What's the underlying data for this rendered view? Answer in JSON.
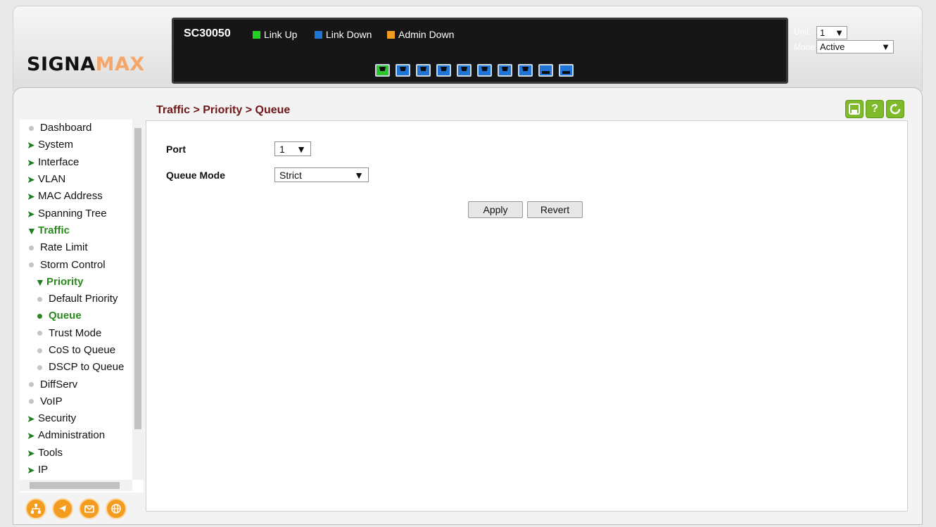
{
  "header": {
    "logo_main": "SIGNA",
    "logo_accent": "MAX",
    "model": "SC30050",
    "legend": [
      {
        "label": "Link Up",
        "color": "#22d022"
      },
      {
        "label": "Link Down",
        "color": "#1f74d6"
      },
      {
        "label": "Admin Down",
        "color": "#f29c1f"
      }
    ],
    "ports": [
      "up",
      "down",
      "down",
      "down",
      "down",
      "down",
      "down",
      "down",
      "sfp",
      "sfp"
    ],
    "unit_label": "Unit",
    "unit_value": "1",
    "mode_label": "Mode",
    "mode_value": "Active"
  },
  "sidebar": {
    "items": [
      {
        "label": "Dashboard",
        "type": "leaf"
      },
      {
        "label": "System",
        "type": "folder"
      },
      {
        "label": "Interface",
        "type": "folder"
      },
      {
        "label": "VLAN",
        "type": "folder"
      },
      {
        "label": "MAC Address",
        "type": "folder"
      },
      {
        "label": "Spanning Tree",
        "type": "folder"
      },
      {
        "label": "Traffic",
        "type": "open"
      },
      {
        "label": "Rate Limit",
        "type": "leaf"
      },
      {
        "label": "Storm Control",
        "type": "leaf"
      },
      {
        "label": "Priority",
        "type": "open"
      },
      {
        "label": "Default Priority",
        "type": "leaf"
      },
      {
        "label": "Queue",
        "type": "current"
      },
      {
        "label": "Trust Mode",
        "type": "leaf"
      },
      {
        "label": "CoS to Queue",
        "type": "leaf"
      },
      {
        "label": "DSCP to Queue",
        "type": "leaf"
      },
      {
        "label": "DiffServ",
        "type": "leaf"
      },
      {
        "label": "VoIP",
        "type": "leaf"
      },
      {
        "label": "Security",
        "type": "folder"
      },
      {
        "label": "Administration",
        "type": "folder"
      },
      {
        "label": "Tools",
        "type": "folder"
      },
      {
        "label": "IP",
        "type": "folder"
      }
    ]
  },
  "content": {
    "breadcrumb": "Traffic > Priority > Queue",
    "port_label": "Port",
    "port_value": "1",
    "queue_mode_label": "Queue Mode",
    "queue_mode_value": "Strict",
    "apply_label": "Apply",
    "revert_label": "Revert"
  },
  "toolbar": {
    "save_icon": "save-icon",
    "help_icon": "help-icon",
    "refresh_icon": "refresh-icon"
  },
  "bottom_icons": [
    "network-icon",
    "link-icon",
    "mail-icon",
    "globe-icon"
  ]
}
